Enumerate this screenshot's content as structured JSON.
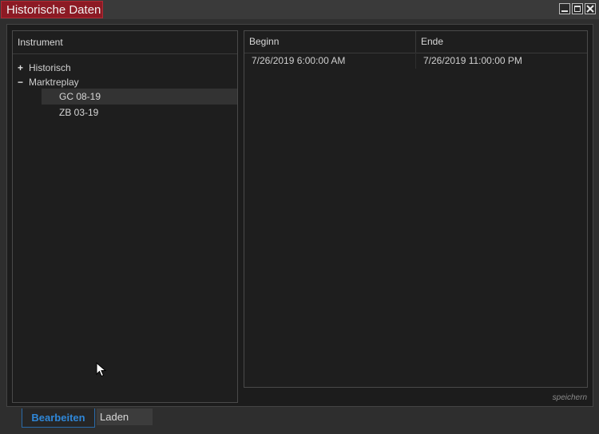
{
  "window": {
    "title": "Historische Daten"
  },
  "left_panel": {
    "header": "Instrument",
    "tree": {
      "historisch": {
        "sign": "+",
        "label": "Historisch"
      },
      "marktreplay": {
        "sign": "−",
        "label": "Marktreplay"
      }
    },
    "leaves": [
      "GC 08-19",
      "ZB 03-19"
    ]
  },
  "right_panel": {
    "columns": [
      "Beginn",
      "Ende"
    ],
    "rows": [
      {
        "beginn": "7/26/2019 6:00:00 AM",
        "ende": "7/26/2019 11:00:00 PM"
      }
    ]
  },
  "footer": {
    "save_label": "speichern",
    "tabs": [
      "Bearbeiten",
      "Laden"
    ]
  },
  "colors": {
    "title_accent": "#8c1a24",
    "active_tab": "#2f87d8"
  }
}
